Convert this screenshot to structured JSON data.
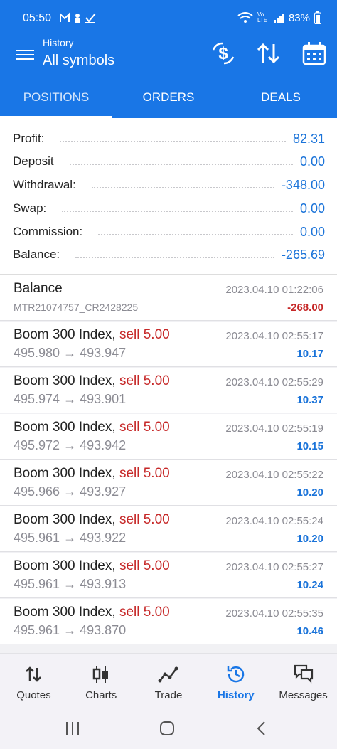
{
  "status": {
    "time": "05:50",
    "battery": "83%",
    "lte": "Vo LTE"
  },
  "header": {
    "subtitle": "History",
    "title": "All symbols"
  },
  "tabs": [
    "POSITIONS",
    "ORDERS",
    "DEALS"
  ],
  "summary": [
    {
      "label": "Profit:",
      "value": "82.31"
    },
    {
      "label": "Deposit",
      "value": "0.00"
    },
    {
      "label": "Withdrawal:",
      "value": "-348.00"
    },
    {
      "label": "Swap:",
      "value": "0.00"
    },
    {
      "label": "Commission:",
      "value": "0.00"
    },
    {
      "label": "Balance:",
      "value": "-265.69"
    }
  ],
  "balance_entry": {
    "name": "Balance",
    "ref": "MTR21074757_CR2428225",
    "date": "2023.04.10 01:22:06",
    "amount": "-268.00"
  },
  "deals": [
    {
      "symbol": "Boom 300 Index,",
      "side": "sell 5.00",
      "prices": "495.980 → 493.947",
      "date": "2023.04.10 02:55:17",
      "profit": "10.17"
    },
    {
      "symbol": "Boom 300 Index,",
      "side": "sell 5.00",
      "prices": "495.974 → 493.901",
      "date": "2023.04.10 02:55:29",
      "profit": "10.37"
    },
    {
      "symbol": "Boom 300 Index,",
      "side": "sell 5.00",
      "prices": "495.972 → 493.942",
      "date": "2023.04.10 02:55:19",
      "profit": "10.15"
    },
    {
      "symbol": "Boom 300 Index,",
      "side": "sell 5.00",
      "prices": "495.966 → 493.927",
      "date": "2023.04.10 02:55:22",
      "profit": "10.20"
    },
    {
      "symbol": "Boom 300 Index,",
      "side": "sell 5.00",
      "prices": "495.961 → 493.922",
      "date": "2023.04.10 02:55:24",
      "profit": "10.20"
    },
    {
      "symbol": "Boom 300 Index,",
      "side": "sell 5.00",
      "prices": "495.961 → 493.913",
      "date": "2023.04.10 02:55:27",
      "profit": "10.24"
    },
    {
      "symbol": "Boom 300 Index,",
      "side": "sell 5.00",
      "prices": "495.961 → 493.870",
      "date": "2023.04.10 02:55:35",
      "profit": "10.46"
    }
  ],
  "bottom_nav": [
    {
      "label": "Quotes",
      "icon": "quotes-icon"
    },
    {
      "label": "Charts",
      "icon": "charts-icon"
    },
    {
      "label": "Trade",
      "icon": "trade-icon"
    },
    {
      "label": "History",
      "icon": "history-icon"
    },
    {
      "label": "Messages",
      "icon": "messages-icon"
    }
  ],
  "colors": {
    "primary": "#1976e6",
    "negative": "#c62828",
    "value_blue": "#1a73d9"
  }
}
